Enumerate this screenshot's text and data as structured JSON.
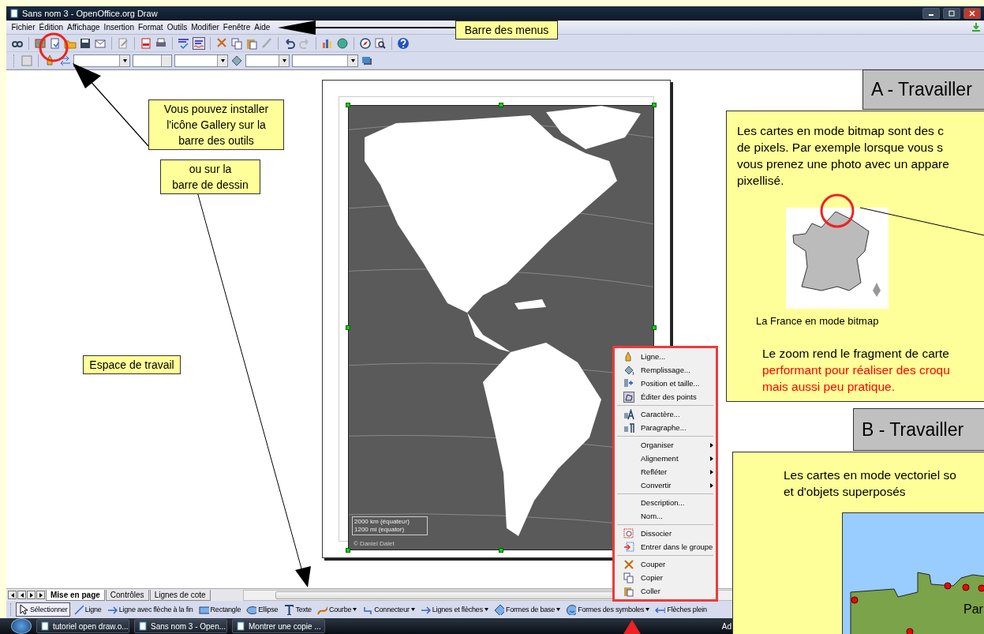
{
  "window": {
    "title": "Sans nom 3 - OpenOffice.org Draw"
  },
  "menu_bar": {
    "items": [
      "Fichier",
      "Édition",
      "Affichage",
      "Insertion",
      "Format",
      "Outils",
      "Modifier",
      "Fenêtre",
      "Aide"
    ]
  },
  "map": {
    "scale_labels": [
      "2000 km (équateur)",
      "1200 mi (equator)"
    ],
    "credit": "© Daniel Dalet"
  },
  "context_menu": {
    "groups": [
      [
        {
          "label": "Ligne...",
          "submenu": false
        },
        {
          "label": "Remplissage...",
          "submenu": false
        },
        {
          "label": "Position et taille...",
          "submenu": false
        },
        {
          "label": "Éditer des points",
          "submenu": false
        }
      ],
      [
        {
          "label": "Caractère...",
          "submenu": false
        },
        {
          "label": "Paragraphe...",
          "submenu": false
        }
      ],
      [
        {
          "label": "Organiser",
          "submenu": true
        },
        {
          "label": "Alignement",
          "submenu": true
        },
        {
          "label": "Refléter",
          "submenu": true
        },
        {
          "label": "Convertir",
          "submenu": true
        }
      ],
      [
        {
          "label": "Description...",
          "submenu": false
        },
        {
          "label": "Nom...",
          "submenu": false
        }
      ],
      [
        {
          "label": "Dissocier",
          "submenu": false
        },
        {
          "label": "Entrer dans le groupe",
          "submenu": false
        }
      ],
      [
        {
          "label": "Couper",
          "submenu": false
        },
        {
          "label": "Copier",
          "submenu": false
        },
        {
          "label": "Coller",
          "submenu": false
        }
      ]
    ]
  },
  "page_tabs": [
    {
      "label": "Mise en page",
      "selected": true
    },
    {
      "label": "Contrôles",
      "selected": false
    },
    {
      "label": "Lignes de cote",
      "selected": false
    }
  ],
  "drawing_toolbar": [
    {
      "label": "Sélectionner",
      "selected": true,
      "has_menu": false
    },
    {
      "label": "Ligne",
      "selected": false,
      "has_menu": false
    },
    {
      "label": "Ligne avec flèche à la fin",
      "selected": false,
      "has_menu": false
    },
    {
      "label": "Rectangle",
      "selected": false,
      "has_menu": false
    },
    {
      "label": "Ellipse",
      "selected": false,
      "has_menu": false
    },
    {
      "label": "Texte",
      "selected": false,
      "has_menu": false
    },
    {
      "label": "Courbe",
      "selected": false,
      "has_menu": true
    },
    {
      "label": "Connecteur",
      "selected": false,
      "has_menu": true
    },
    {
      "label": "Lignes et flèches",
      "selected": false,
      "has_menu": true
    },
    {
      "label": "Formes de base",
      "selected": false,
      "has_menu": true
    },
    {
      "label": "Formes des symboles",
      "selected": false,
      "has_menu": true
    },
    {
      "label": "Flèches plein",
      "selected": false,
      "has_menu": false
    }
  ],
  "taskbar": {
    "items": [
      "tutoriel open draw.o...",
      "Sans nom 3 - Open...",
      "Montrer une copie ..."
    ],
    "tray_text": "Ad"
  },
  "callouts": {
    "menu_bar": "Barre des menus",
    "gallery": [
      "Vous pouvez installer",
      "l'icône Gallery sur la",
      "barre des outils"
    ],
    "drawing_bar": [
      "ou sur la",
      "barre de dessin"
    ],
    "workspace": "Espace de travail"
  },
  "panel_a": {
    "title": "A - Travailler",
    "lines": [
      "Les cartes en mode bitmap sont des c",
      "de pixels. Par exemple lorsque vous s",
      "vous prenez une photo avec un appare",
      "pixellisé."
    ],
    "caption": "La France en mode bitmap",
    "note_lines": [
      {
        "text": "Le zoom rend le fragment de carte",
        "highlight": false
      },
      {
        "text": "performant pour réaliser des croqu",
        "highlight": true
      },
      {
        "text": "mais aussi peu pratique.",
        "highlight": true
      }
    ]
  },
  "panel_b": {
    "title": "B - Travailler",
    "lines": [
      "Les cartes en mode vectoriel so",
      "et d'objets superposés"
    ],
    "map_label": "Par"
  }
}
